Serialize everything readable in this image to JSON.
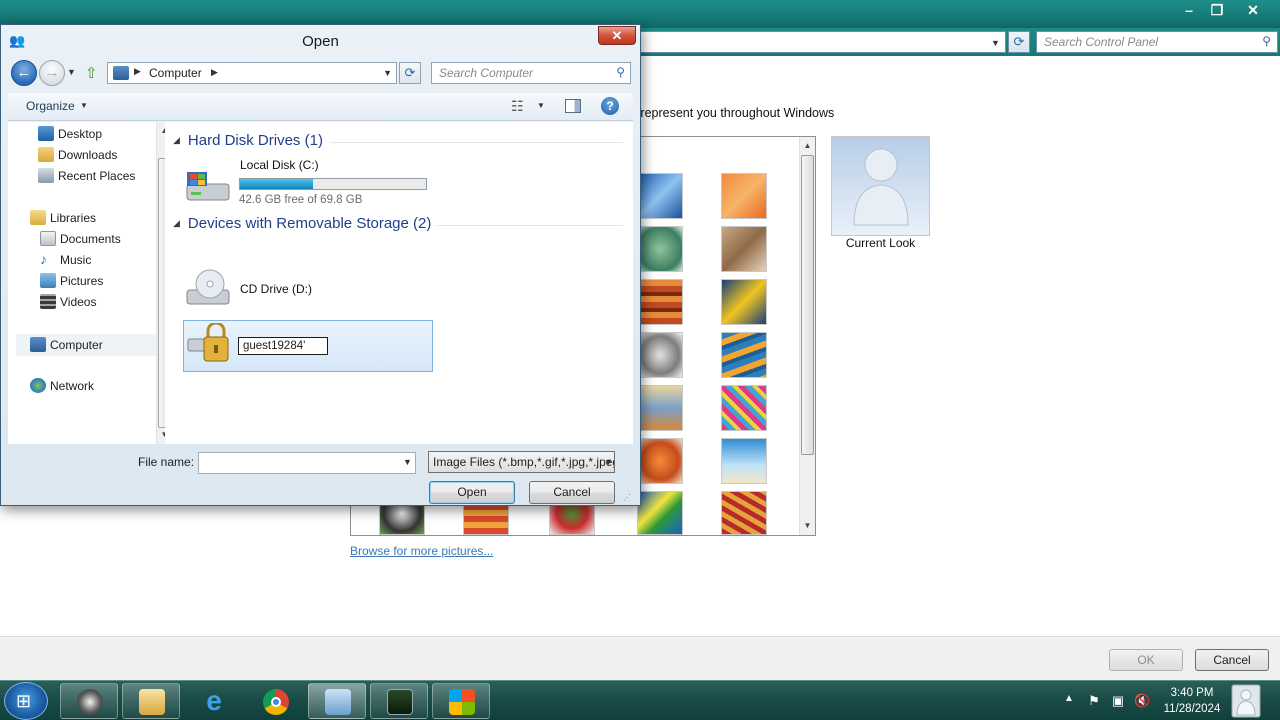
{
  "background_window": {
    "search_placeholder": "Search Control Panel",
    "description": "d represent you throughout Windows",
    "current_look_label": "Current Look",
    "browse_link": "Browse for more pictures...",
    "ok_label": "OK",
    "cancel_label": "Cancel"
  },
  "dialog": {
    "title": "Open",
    "address": {
      "location": "Computer"
    },
    "search_placeholder": "Search Computer",
    "toolbar": {
      "organize_label": "Organize"
    },
    "nav_pane": {
      "favorites": [
        {
          "label": "Desktop",
          "icon": "desktop-icon"
        },
        {
          "label": "Downloads",
          "icon": "downloads-icon"
        },
        {
          "label": "Recent Places",
          "icon": "recent-places-icon"
        }
      ],
      "libraries": {
        "label": "Libraries",
        "items": [
          {
            "label": "Documents",
            "icon": "documents-icon"
          },
          {
            "label": "Music",
            "icon": "music-icon"
          },
          {
            "label": "Pictures",
            "icon": "pictures-icon"
          },
          {
            "label": "Videos",
            "icon": "videos-icon"
          }
        ]
      },
      "computer_label": "Computer",
      "network_label": "Network"
    },
    "content": {
      "hard_disk_header": "Hard Disk Drives (1)",
      "local_disk": {
        "name": "Local Disk (C:)",
        "free_text": "42.6 GB free of 69.8 GB",
        "used_fraction": 0.39
      },
      "removable_header": "Devices with Removable Storage (2)",
      "cd_drive": {
        "name": "CD Drive (D:)"
      },
      "usb_drive": {
        "rename_value": "guest19284'"
      }
    },
    "bottom": {
      "filename_label": "File name:",
      "filename_value": "",
      "filetype_selected": "Image Files (*.bmp,*.gif,*.jpg,*.jpeg,*.png)",
      "open_label": "Open",
      "cancel_label": "Cancel"
    }
  },
  "taskbar": {
    "clock_time": "3:40 PM",
    "clock_date": "11/28/2024"
  },
  "colors": {
    "titlebar_teal": "#167a76",
    "link_blue": "#3c78b5",
    "group_header_blue": "#1e3f8c",
    "disk_bar_blue": "#2ba4d6",
    "close_red": "#c0361f"
  }
}
